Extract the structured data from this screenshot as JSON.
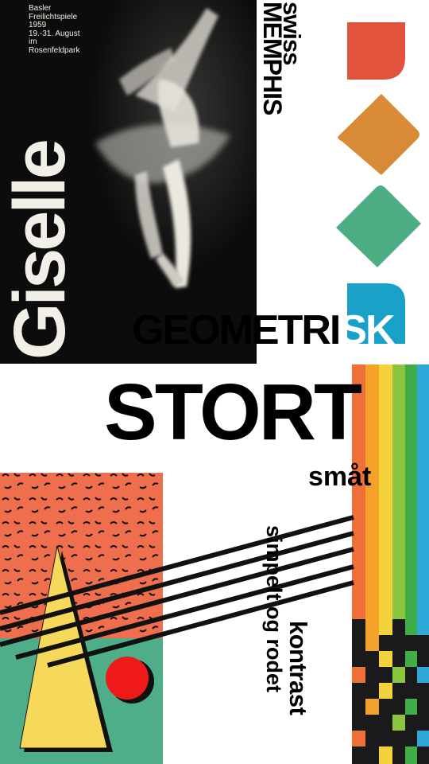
{
  "poster": {
    "info_lines": [
      "Basler",
      "Freilichtspiele",
      "1959",
      "19.-31. August",
      "im",
      "Rosenfeldpark"
    ],
    "title": "Giselle"
  },
  "headline": {
    "swiss": "swiss",
    "memphis": "MEMPHIS",
    "geometrisk_dark": "GEOMETRI",
    "geometrisk_light": "SK",
    "stort": "STORT",
    "smat": "småt",
    "simpelt": "simpelt og rodet",
    "kontrast": "kontrast"
  },
  "colors": {
    "poster_bg": "#0c0c0c",
    "red_orange": "#e2533c",
    "orange": "#d98a36",
    "green": "#4dae83",
    "blue": "#19a1c8",
    "memphis_coral": "#ef6e4e",
    "memphis_teal": "#4fae8a",
    "memphis_yellow": "#f6d95a",
    "memphis_red": "#ef1b1b",
    "rainbow": [
      "#ef6f38",
      "#f4a22a",
      "#f3d23a",
      "#8cc63f",
      "#3fae49",
      "#2eaad9"
    ]
  }
}
